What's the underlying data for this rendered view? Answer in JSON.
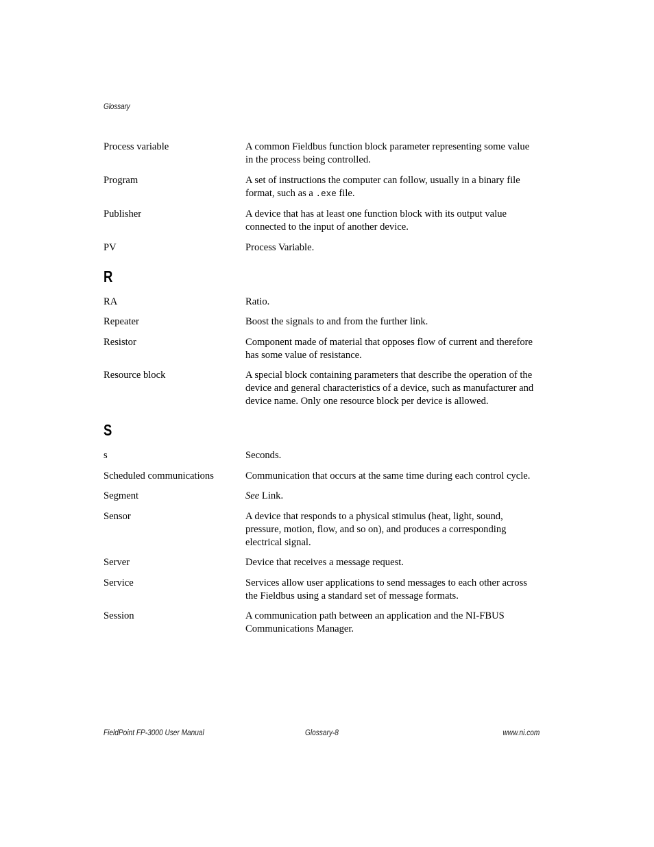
{
  "page": {
    "running_head": "Glossary",
    "background_color": "#ffffff",
    "text_color": "#000000"
  },
  "sections": [
    {
      "letter": "",
      "entries": [
        {
          "term": "Process variable",
          "definition": "A common Fieldbus function block parameter representing some value in the process being controlled."
        },
        {
          "term": "Program",
          "definition_pre": "A set of instructions the computer can follow, usually in a binary file format, such as a ",
          "definition_mono": ".exe",
          "definition_post": " file."
        },
        {
          "term": "Publisher",
          "definition": "A device that has at least one function block with its output value connected to the input of another device."
        },
        {
          "term": "PV",
          "definition": "Process Variable."
        }
      ]
    },
    {
      "letter": "R",
      "entries": [
        {
          "term": "RA",
          "definition": "Ratio."
        },
        {
          "term": "Repeater",
          "definition": "Boost the signals to and from the further link."
        },
        {
          "term": "Resistor",
          "definition": "Component made of material that opposes flow of current and therefore has some value of resistance."
        },
        {
          "term": "Resource block",
          "definition": "A special block containing parameters that describe the operation of the device and general characteristics of a device, such as manufacturer and device name. Only one resource block per device is allowed."
        }
      ]
    },
    {
      "letter": "S",
      "entries": [
        {
          "term": "s",
          "definition": "Seconds."
        },
        {
          "term": "Scheduled communications",
          "definition": "Communication that occurs at the same time during each control cycle."
        },
        {
          "term": "Segment",
          "definition_italic": "See",
          "definition_post": " Link."
        },
        {
          "term": "Sensor",
          "definition": "A device that responds to a physical stimulus (heat, light, sound, pressure, motion, flow, and so on), and produces a corresponding electrical signal."
        },
        {
          "term": "Server",
          "definition": "Device that receives a message request."
        },
        {
          "term": "Service",
          "definition": "Services allow user applications to send messages to each other across the Fieldbus using a standard set of message formats."
        },
        {
          "term": "Session",
          "definition": "A communication path between an application and the NI-FBUS Communications Manager."
        }
      ]
    }
  ],
  "footer": {
    "left": "FieldPoint FP-3000 User Manual",
    "center": "Glossary-8",
    "right": "www.ni.com"
  }
}
